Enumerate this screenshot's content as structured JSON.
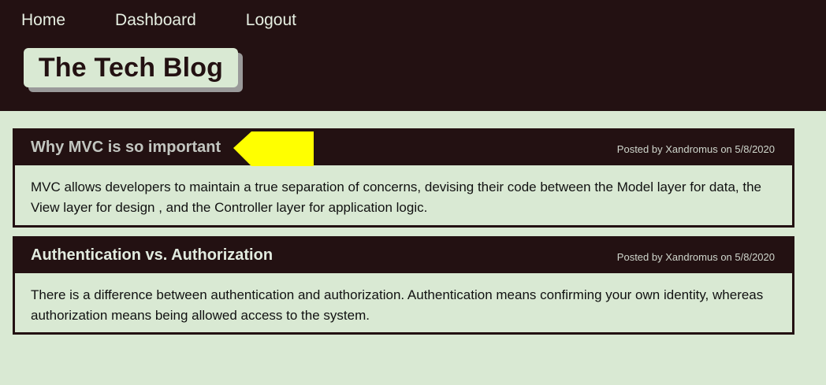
{
  "nav": {
    "items": [
      "Home",
      "Dashboard",
      "Logout"
    ]
  },
  "site": {
    "title": "The Tech Blog"
  },
  "posts": [
    {
      "title": "Why MVC is so important",
      "meta": "Posted by Xandromus on 5/8/2020",
      "body": "MVC allows developers to maintain a true separation of concerns, devising their code between the Model layer for data, the View layer for design , and the Controller layer for application logic."
    },
    {
      "title": "Authentication vs. Authorization",
      "meta": "Posted by Xandromus on 5/8/2020",
      "body": "There is a difference between authentication and authorization. Authentication means confirming your own identity, whereas authorization means being allowed access to the system."
    }
  ],
  "colors": {
    "header_bg": "#231112",
    "page_bg": "#d9e9d3",
    "arrow": "#ffff00"
  }
}
